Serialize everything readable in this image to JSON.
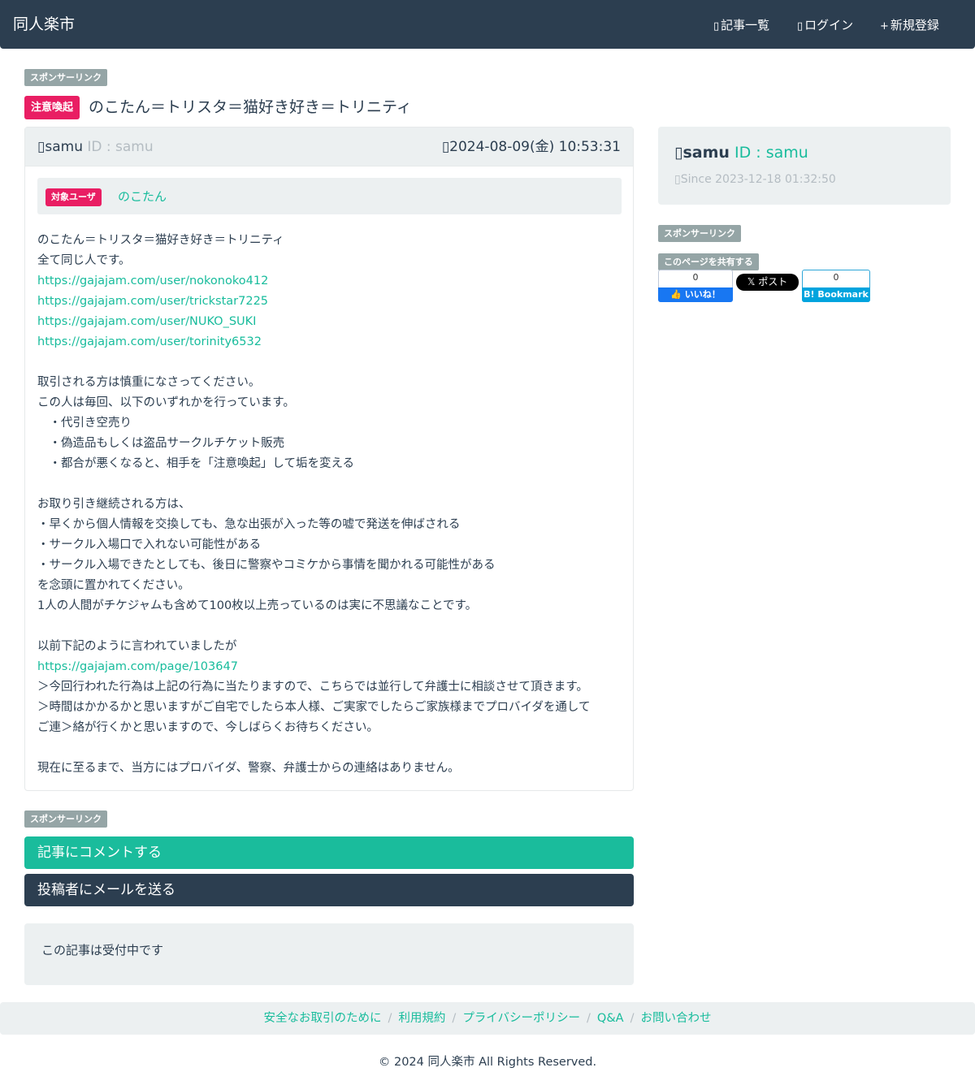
{
  "header": {
    "brand": "同人楽市",
    "nav": [
      {
        "icon": "list-icon",
        "glyph": "▯",
        "label": "記事一覧"
      },
      {
        "icon": "login-icon",
        "glyph": "▯",
        "label": "ログイン"
      },
      {
        "icon": "plus-icon",
        "glyph": "+",
        "label": "新規登録"
      }
    ]
  },
  "sponsor_label": "スポンサーリンク",
  "post": {
    "alert_tag": "注意喚起",
    "title": "のこたん＝トリスタ＝猫好き好き＝トリニティ",
    "author_icon": "▯",
    "author_name": "samu",
    "author_id": " ID : samu",
    "date_icon": "▯",
    "date": "2024-08-09(金) 10:53:31",
    "target_tag": "対象ユーザ",
    "target_user": "のこたん",
    "body_lines": [
      {
        "text": "のこたん＝トリスタ＝猫好き好き＝トリニティ",
        "link": false
      },
      {
        "text": "全て同じ人です。",
        "link": false
      },
      {
        "text": "https://gajajam.com/user/nokonoko412",
        "link": true
      },
      {
        "text": "https://gajajam.com/user/trickstar7225",
        "link": true
      },
      {
        "text": "https://gajajam.com/user/NUKO_SUKI",
        "link": true
      },
      {
        "text": "https://gajajam.com/user/torinity6532",
        "link": true
      },
      {
        "text": "",
        "link": false
      },
      {
        "text": "取引される方は慎重になさってください。",
        "link": false
      },
      {
        "text": "この人は毎回、以下のいずれかを行っています。",
        "link": false
      },
      {
        "text": "　・代引き空売り",
        "link": false
      },
      {
        "text": "　・偽造品もしくは盗品サークルチケット販売",
        "link": false
      },
      {
        "text": "　・都合が悪くなると、相手を「注意喚起」して垢を変える",
        "link": false
      },
      {
        "text": "",
        "link": false
      },
      {
        "text": "お取り引き継続される方は、",
        "link": false
      },
      {
        "text": "・早くから個人情報を交換しても、急な出張が入った等の嘘で発送を伸ばされる",
        "link": false
      },
      {
        "text": "・サークル入場口で入れない可能性がある",
        "link": false
      },
      {
        "text": "・サークル入場できたとしても、後日に警察やコミケから事情を聞かれる可能性がある",
        "link": false
      },
      {
        "text": "を念頭に置かれてください。",
        "link": false
      },
      {
        "text": "1人の人間がチケジャムも含めて100枚以上売っているのは実に不思議なことです。",
        "link": false
      },
      {
        "text": "",
        "link": false
      },
      {
        "text": "以前下記のように言われていましたが",
        "link": false
      },
      {
        "text": "https://gajajam.com/page/103647",
        "link": true
      },
      {
        "text": "＞今回行われた行為は上記の行為に当たりますので、こちらでは並行して弁護士に相談させて頂きます。",
        "link": false
      },
      {
        "text": "＞時間はかかるかと思いますがご自宅でしたら本人様、ご実家でしたらご家族様までプロバイダを通して",
        "link": false
      },
      {
        "text": "ご連＞絡が行くかと思いますので、今しばらくお待ちください。",
        "link": false
      },
      {
        "text": "",
        "link": false
      },
      {
        "text": "現在に至るまで、当方にはプロバイダ、警察、弁護士からの連絡はありません。",
        "link": false
      }
    ]
  },
  "profile": {
    "icon": "▯",
    "name": "samu",
    "id_text": " ID : samu",
    "since_icon": "▯",
    "since": "Since 2023-12-18 01:32:50"
  },
  "share": {
    "label": "このページを共有する",
    "fb_count": "0",
    "fb_label": "👍 いいね！",
    "x_label": "𝕏 ポスト",
    "hb_count": "0",
    "hb_label": "B! Bookmark"
  },
  "actions": {
    "comment": "記事にコメントする",
    "mail": "投稿者にメールを送る"
  },
  "status": "この記事は受付中です",
  "footer": {
    "links": [
      "安全なお取引のために",
      "利用規約",
      "プライバシーポリシー",
      "Q&A",
      "お問い合わせ"
    ],
    "separator": "/",
    "copyright": "© 2024 同人楽市 All Rights Reserved."
  },
  "colors": {
    "navbar": "#2c3e50",
    "accent": "#18bc9c",
    "alert": "#e91e63",
    "panel": "#ecf0f1"
  }
}
